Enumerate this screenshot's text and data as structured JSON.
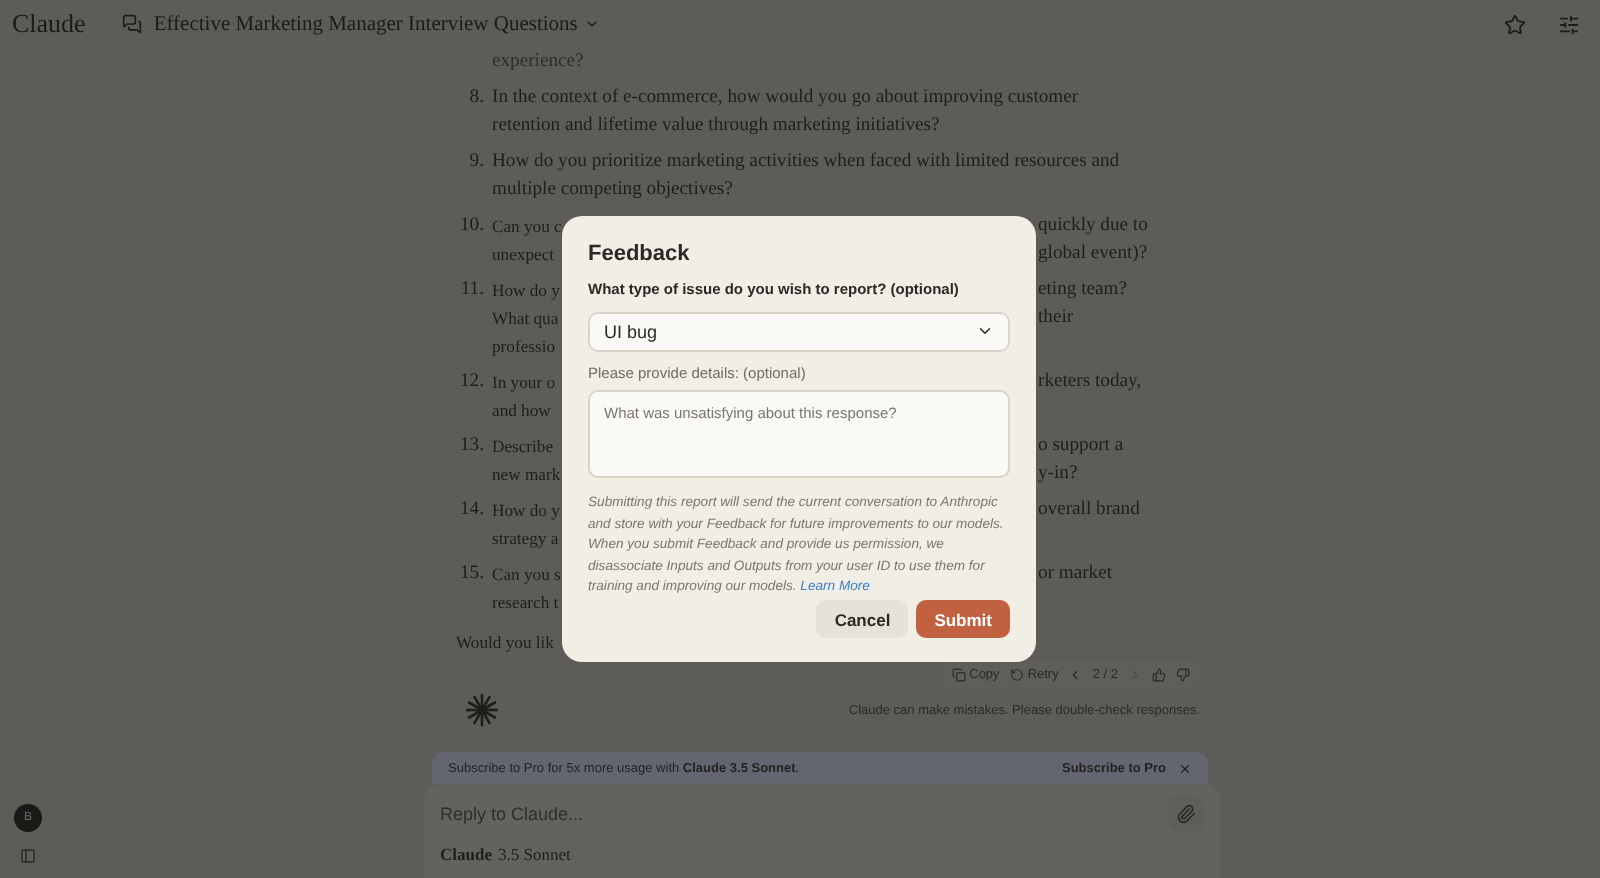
{
  "header": {
    "logo": "Claude",
    "title": "Effective Marketing Manager Interview Questions"
  },
  "conversation": {
    "faded_line": "experience?",
    "items": [
      {
        "number": "8.",
        "lines": [
          {
            "left": "In the context of e-commerce, how would you go about improving customer"
          },
          {
            "left": "retention and lifetime value through marketing initiatives?"
          }
        ]
      },
      {
        "number": "9.",
        "lines": [
          {
            "left": "How do you prioritize marketing activities when faced with limited resources and"
          },
          {
            "left": "multiple competing objectives?"
          }
        ]
      },
      {
        "number": "10.",
        "lines": [
          {
            "left": "Can you c",
            "right": "quickly due to"
          },
          {
            "left": "unexpect",
            "right": "global event)?"
          }
        ]
      },
      {
        "number": "11.",
        "lines": [
          {
            "left": "How do y",
            "right": "eting team?"
          },
          {
            "left": "What qua",
            "right": "their"
          },
          {
            "left": "professio"
          }
        ]
      },
      {
        "number": "12.",
        "lines": [
          {
            "left": "In your o",
            "right": "rketers today,"
          },
          {
            "left": "and how"
          }
        ]
      },
      {
        "number": "13.",
        "lines": [
          {
            "left": "Describe",
            "right": "o support a"
          },
          {
            "left": "new mark",
            "right": "y-in?"
          }
        ]
      },
      {
        "number": "14.",
        "lines": [
          {
            "left": "How do y",
            "right": "overall brand"
          },
          {
            "left": "strategy a"
          }
        ]
      },
      {
        "number": "15.",
        "lines": [
          {
            "left": "Can you s",
            "right": "or market"
          },
          {
            "left": "research t"
          }
        ]
      }
    ],
    "closing": "Would you lik"
  },
  "actions": {
    "copy": "Copy",
    "retry": "Retry",
    "pager": "2 / 2"
  },
  "disclaimer": "Claude can make mistakes. Please double-check responses.",
  "banner": {
    "text": "Subscribe to Pro for 5x more usage with **Claude 3.5 Sonnet**.",
    "action": "Subscribe to Pro"
  },
  "composer": {
    "placeholder": "Reply to Claude...",
    "model_name": "Claude",
    "model_version": "3.5 Sonnet"
  },
  "sidebar": {
    "avatar": "B"
  },
  "dialog": {
    "title": "Feedback",
    "question": "What type of issue do you wish to report? (optional)",
    "issue_type": "UI bug",
    "details_label": "Please provide details: (optional)",
    "details_placeholder": "What was unsatisfying about this response?",
    "notice": "Submitting this report will send the current conversation to Anthropic and store with your Feedback for future improvements to our models. When you submit Feedback and provide us permission, we disassociate Inputs and Outputs from your user ID to use them for training and improving our models.",
    "link": "Learn More",
    "buttons": [
      {
        "label": "Cancel",
        "kind": "secondary"
      },
      {
        "label": "Submit",
        "kind": "primary"
      }
    ]
  }
}
